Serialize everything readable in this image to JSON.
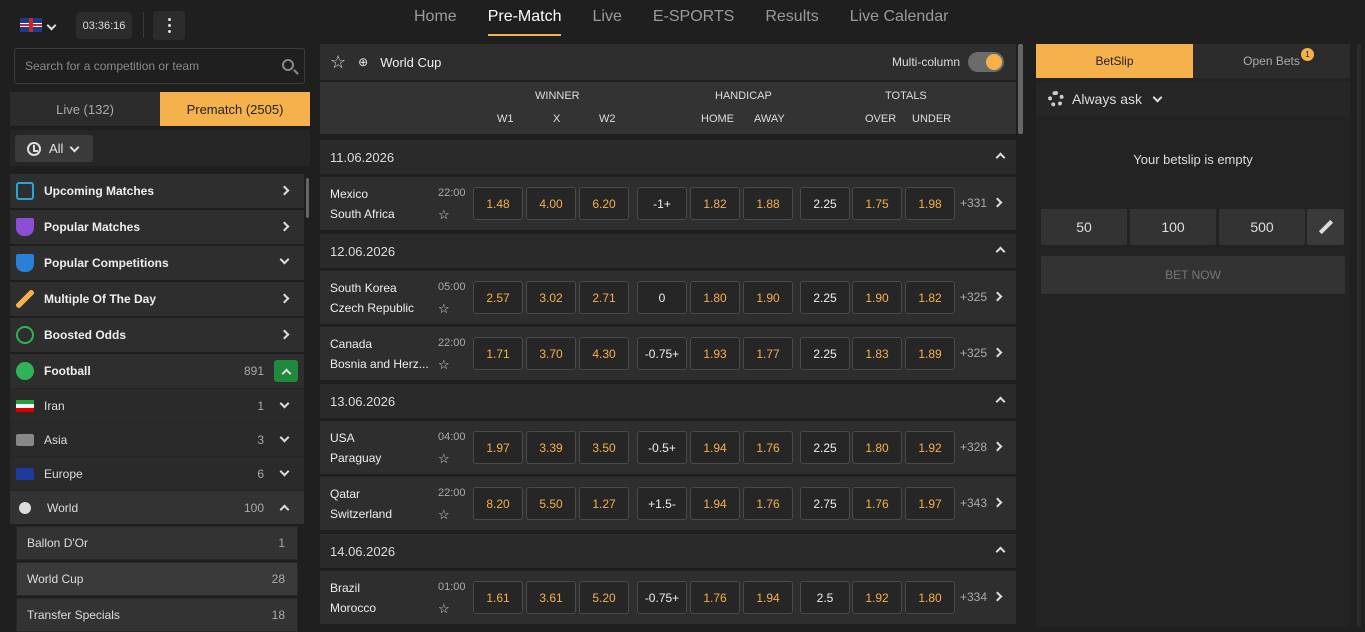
{
  "header": {
    "time": "03:36:16",
    "nav": [
      "Home",
      "Pre-Match",
      "Live",
      "E-SPORTS",
      "Results",
      "Live Calendar"
    ]
  },
  "left": {
    "search_placeholder": "Search for a competition or team",
    "live_tab": "Live (132)",
    "prematch_tab": "Prematch (2505)",
    "filter_all": "All",
    "menu": [
      {
        "label": "Upcoming Matches",
        "icon_color": "#2aa6d6"
      },
      {
        "label": "Popular Matches",
        "icon_color": "#8a4fd6"
      },
      {
        "label": "Popular Competitions",
        "icon_color": "#2a7fd6"
      },
      {
        "label": "Multiple Of The Day",
        "icon_color": "#f5b14c"
      },
      {
        "label": "Boosted Odds",
        "icon_color": "#2fb35a"
      }
    ],
    "sport": {
      "label": "Football",
      "count": "891"
    },
    "regions": [
      {
        "label": "Iran",
        "count": "1"
      },
      {
        "label": "Asia",
        "count": "3"
      },
      {
        "label": "Europe",
        "count": "6"
      },
      {
        "label": "World",
        "count": "100"
      }
    ],
    "competitions": [
      {
        "label": "Ballon D'Or",
        "count": "1"
      },
      {
        "label": "World Cup",
        "count": "28"
      },
      {
        "label": "Transfer Specials",
        "count": "18"
      }
    ]
  },
  "center": {
    "title": "World Cup",
    "multi_column": "Multi-column",
    "groups": [
      "WINNER",
      "HANDICAP",
      "TOTALS"
    ],
    "cols": [
      "W1",
      "X",
      "W2",
      "HOME",
      "AWAY",
      "OVER",
      "UNDER"
    ],
    "dates": [
      "11.06.2026",
      "12.06.2026",
      "13.06.2026",
      "14.06.2026"
    ],
    "matches": [
      {
        "t1": "Mexico",
        "t2": "South Africa",
        "time": "22:00",
        "odds": [
          "1.48",
          "4.00",
          "6.20",
          "-1+",
          "1.82",
          "1.88",
          "2.25",
          "1.75",
          "1.98"
        ],
        "more": "+331"
      },
      {
        "t1": "South Korea",
        "t2": "Czech Republic",
        "time": "05:00",
        "odds": [
          "2.57",
          "3.02",
          "2.71",
          "0",
          "1.80",
          "1.90",
          "2.25",
          "1.90",
          "1.82"
        ],
        "more": "+325"
      },
      {
        "t1": "Canada",
        "t2": "Bosnia and Herz...",
        "time": "22:00",
        "odds": [
          "1.71",
          "3.70",
          "4.30",
          "-0.75+",
          "1.93",
          "1.77",
          "2.25",
          "1.83",
          "1.89"
        ],
        "more": "+325"
      },
      {
        "t1": "USA",
        "t2": "Paraguay",
        "time": "04:00",
        "odds": [
          "1.97",
          "3.39",
          "3.50",
          "-0.5+",
          "1.94",
          "1.76",
          "2.25",
          "1.80",
          "1.92"
        ],
        "more": "+328"
      },
      {
        "t1": "Qatar",
        "t2": "Switzerland",
        "time": "22:00",
        "odds": [
          "8.20",
          "5.50",
          "1.27",
          "+1.5-",
          "1.94",
          "1.76",
          "2.75",
          "1.76",
          "1.97"
        ],
        "more": "+343"
      },
      {
        "t1": "Brazil",
        "t2": "Morocco",
        "time": "01:00",
        "odds": [
          "1.61",
          "3.61",
          "5.20",
          "-0.75+",
          "1.76",
          "1.94",
          "2.5",
          "1.92",
          "1.80"
        ],
        "more": "+334"
      }
    ]
  },
  "betslip": {
    "tab_betslip": "BetSlip",
    "tab_open": "Open Bets",
    "open_count": "1",
    "always_ask": "Always ask",
    "empty": "Your betslip is empty",
    "stakes": [
      "50",
      "100",
      "500"
    ],
    "bet_now": "BET NOW"
  }
}
